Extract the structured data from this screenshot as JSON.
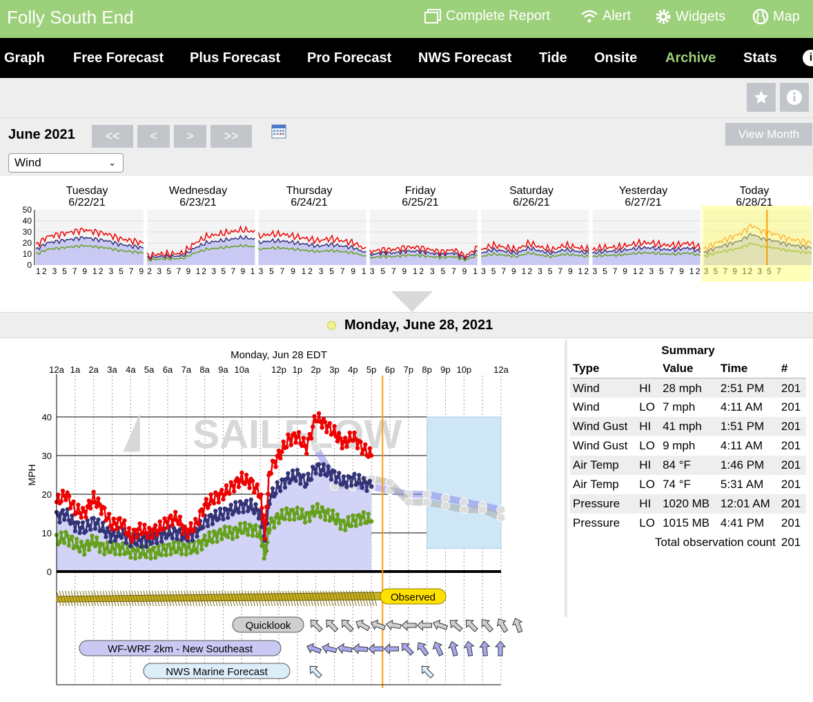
{
  "header": {
    "site_title": "Folly South End",
    "links": [
      {
        "label": "Complete Report",
        "icon": "report-icon"
      },
      {
        "label": "Alert",
        "icon": "wifi-alert-icon"
      },
      {
        "label": "Widgets",
        "icon": "gear-icon"
      },
      {
        "label": "Map",
        "icon": "globe-icon"
      }
    ]
  },
  "nav": {
    "items": [
      "Graph",
      "Free Forecast",
      "Plus Forecast",
      "Pro Forecast",
      "NWS Forecast",
      "Tide",
      "Onsite",
      "Archive",
      "Stats"
    ],
    "active": "Archive",
    "info_glyph": "i"
  },
  "toolbar": {
    "favorite_icon": "star-icon",
    "info_icon": "info-icon"
  },
  "archive": {
    "month_label": "June 2021",
    "pager": [
      "<<",
      "<",
      ">",
      ">>"
    ],
    "view_month_label": "View Month",
    "type_select": {
      "value": "Wind"
    }
  },
  "days": [
    {
      "weekday": "Tuesday",
      "date": "6/22/21",
      "ticks": "12 3 5 7 9 12 3 5 7 9"
    },
    {
      "weekday": "Wednesday",
      "date": "6/23/21",
      "ticks": "2 3 5 7 9 12 3 5 7 9 1"
    },
    {
      "weekday": "Thursday",
      "date": "6/24/21",
      "ticks": "3 5 7 9 12 3 5 7 9 1"
    },
    {
      "weekday": "Friday",
      "date": "6/25/21",
      "ticks": "3 5 7 9 12 3 5 7 9 1"
    },
    {
      "weekday": "Saturday",
      "date": "6/26/21",
      "ticks": "3 5 7 9 12 3 5 7 9 12"
    },
    {
      "weekday": "Yesterday",
      "date": "6/27/21",
      "ticks": "3 5 7 9 12 3 5 7 9 12"
    },
    {
      "weekday": "Today",
      "date": "6/28/21",
      "ticks": "3 5 7 9 12 3 5 7"
    }
  ],
  "strip_axis": {
    "yticks": [
      "50",
      "40",
      "30",
      "20",
      "10",
      "0"
    ],
    "ymax": 50
  },
  "selected_date": "Monday, June 28, 2021",
  "chart_data": {
    "type": "line",
    "title": "Monday, Jun 28 EDT",
    "ylabel": "MPH",
    "ylim": [
      0,
      50
    ],
    "yticks": [
      0,
      10,
      20,
      30,
      40
    ],
    "x_ticks": [
      "12a",
      "1a",
      "2a",
      "3a",
      "4a",
      "5a",
      "6a",
      "7a",
      "8a",
      "9a",
      "10a",
      "",
      "12p",
      "1p",
      "2p",
      "3p",
      "4p",
      "5p",
      "6p",
      "7p",
      "8p",
      "9p",
      "10p",
      "",
      "12a"
    ],
    "current_time_hour": 17.6,
    "series": [
      {
        "name": "Gust",
        "color": "#ee0000",
        "x": [
          0,
          0.5,
          1,
          1.5,
          2,
          2.5,
          3,
          3.5,
          4,
          4.5,
          5,
          5.5,
          6,
          6.5,
          7,
          7.5,
          8,
          8.5,
          9,
          9.5,
          10,
          10.5,
          11,
          11.25,
          11.5,
          12,
          12.5,
          13,
          13.5,
          14,
          14.5,
          15,
          15.5,
          16,
          16.5,
          17
        ],
        "y": [
          18,
          20,
          16,
          15,
          19,
          16,
          12,
          13,
          9,
          11,
          10,
          11,
          13,
          14,
          10,
          12,
          17,
          19,
          20,
          22,
          24,
          23,
          20,
          10,
          26,
          30,
          34,
          35,
          32,
          40,
          38,
          36,
          33,
          35,
          32,
          30
        ]
      },
      {
        "name": "Wind",
        "color": "#333377",
        "x": [
          0,
          0.5,
          1,
          1.5,
          2,
          2.5,
          3,
          3.5,
          4,
          4.5,
          5,
          5.5,
          6,
          6.5,
          7,
          7.5,
          8,
          8.5,
          9,
          9.5,
          10,
          10.5,
          11,
          11.25,
          11.5,
          12,
          12.5,
          13,
          13.5,
          14,
          14.5,
          15,
          15.5,
          16,
          16.5,
          17
        ],
        "y": [
          14,
          15,
          12,
          11,
          13,
          11,
          9,
          10,
          8,
          8,
          8,
          9,
          10,
          10,
          9,
          10,
          13,
          14,
          15,
          16,
          17,
          17,
          15,
          9,
          19,
          22,
          24,
          25,
          23,
          27,
          26,
          25,
          23,
          24,
          23,
          22
        ]
      },
      {
        "name": "Lull",
        "color": "#66a11d",
        "x": [
          0,
          0.5,
          1,
          1.5,
          2,
          2.5,
          3,
          3.5,
          4,
          4.5,
          5,
          5.5,
          6,
          6.5,
          7,
          7.5,
          8,
          8.5,
          9,
          9.5,
          10,
          10.5,
          11,
          11.25,
          11.5,
          12,
          12.5,
          13,
          13.5,
          14,
          14.5,
          15,
          15.5,
          16,
          16.5,
          17
        ],
        "y": [
          8,
          9,
          7,
          6,
          8,
          6,
          6,
          6,
          5,
          5,
          5,
          5,
          6,
          6,
          6,
          6,
          8,
          9,
          10,
          10,
          11,
          11,
          10,
          4,
          12,
          14,
          15,
          15,
          14,
          16,
          15,
          14,
          12,
          13,
          14,
          13
        ]
      },
      {
        "name": "WF-WRF 2km - New Southeast",
        "color": "#8888ee",
        "x": [
          14,
          15,
          16,
          17,
          18,
          19,
          20,
          21,
          22,
          23,
          24
        ],
        "y": [
          32,
          24,
          22,
          22,
          21,
          20,
          20,
          19,
          18,
          17,
          16
        ]
      },
      {
        "name": "Quicklook",
        "color": "#aaaaaa",
        "x": [
          15,
          16,
          17,
          18,
          19,
          20,
          21,
          22,
          23,
          24
        ],
        "y": [
          22,
          23,
          24,
          23,
          18,
          18,
          17,
          16,
          16,
          14
        ]
      }
    ],
    "forecast_box": {
      "x_range": [
        20,
        24
      ],
      "y_range": [
        6,
        40
      ],
      "label": "NWS Marine Forecast"
    },
    "legend": [
      "Observed",
      "Quicklook",
      "WF-WRF 2km - New Southeast",
      "NWS Marine Forecast"
    ],
    "watermark": "SAILFLOW"
  },
  "summary": {
    "title": "Summary",
    "headers": [
      "Type",
      "",
      "Value",
      "Time",
      "#"
    ],
    "rows": [
      [
        "Wind",
        "HI",
        "28 mph",
        "2:51 PM",
        "201"
      ],
      [
        "Wind",
        "LO",
        "7 mph",
        "4:11 AM",
        "201"
      ],
      [
        "Wind Gust",
        "HI",
        "41 mph",
        "1:51 PM",
        "201"
      ],
      [
        "Wind Gust",
        "LO",
        "9 mph",
        "4:11 AM",
        "201"
      ],
      [
        "Air Temp",
        "HI",
        "84 °F",
        "1:46 PM",
        "201"
      ],
      [
        "Air Temp",
        "LO",
        "74 °F",
        "5:31 AM",
        "201"
      ],
      [
        "Pressure",
        "HI",
        "1020 MB",
        "12:01 AM",
        "201"
      ],
      [
        "Pressure",
        "LO",
        "1015 MB",
        "4:41 PM",
        "201"
      ]
    ],
    "total_label": "Total observation count",
    "total_value": "201"
  }
}
